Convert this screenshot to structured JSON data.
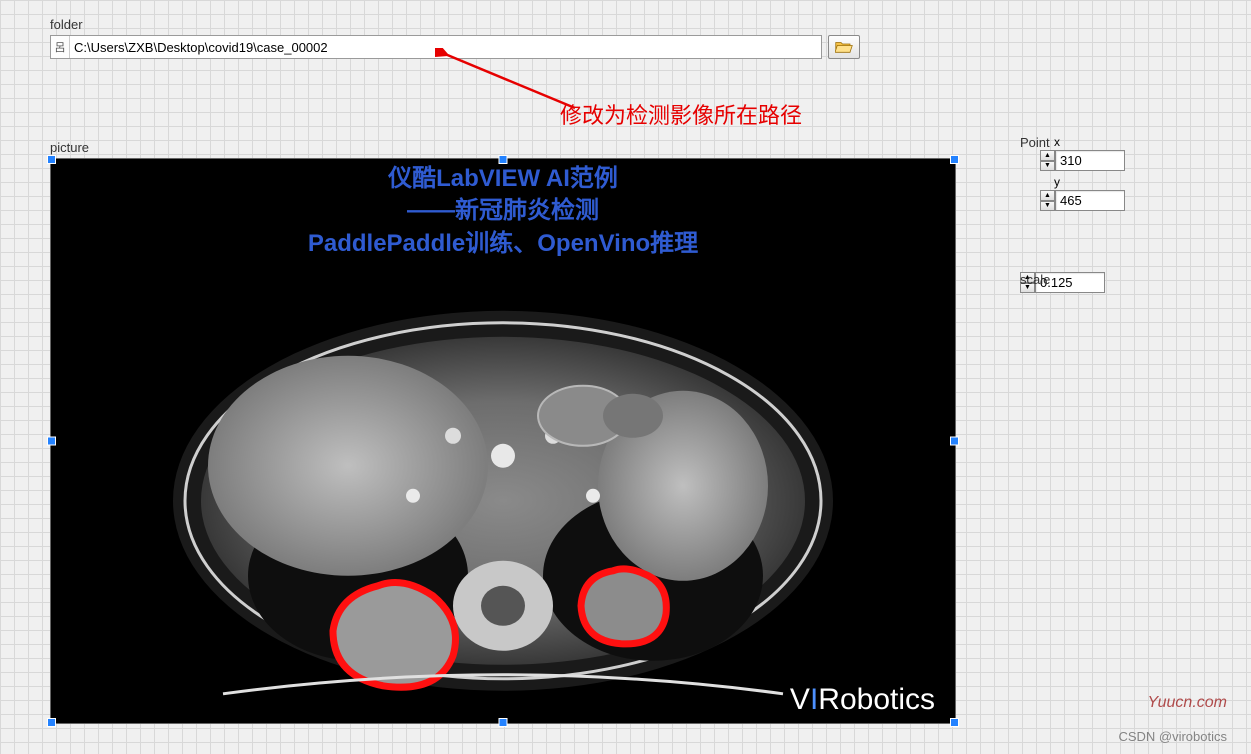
{
  "folder": {
    "label": "folder",
    "path": "C:\\Users\\ZXB\\Desktop\\covid19\\case_00002",
    "icon_name": "path-glyph"
  },
  "annotation": {
    "text": "修改为检测影像所在路径"
  },
  "picture": {
    "label": "picture",
    "overlay_line1": "仪酷LabVIEW AI范例",
    "overlay_line2": "——新冠肺炎检测",
    "overlay_line3": "PaddlePaddle训练、OpenVino推理",
    "logo_prefix": "V",
    "logo_accent": "I",
    "logo_rest": "Robotics"
  },
  "point": {
    "label": "Point",
    "x_label": "x",
    "x_value": "310",
    "y_label": "y",
    "y_value": "465"
  },
  "scale": {
    "label": "scale",
    "value": "0.125"
  },
  "watermarks": {
    "yuucn": "Yuucn.com",
    "csdn": "CSDN @virobotics"
  }
}
